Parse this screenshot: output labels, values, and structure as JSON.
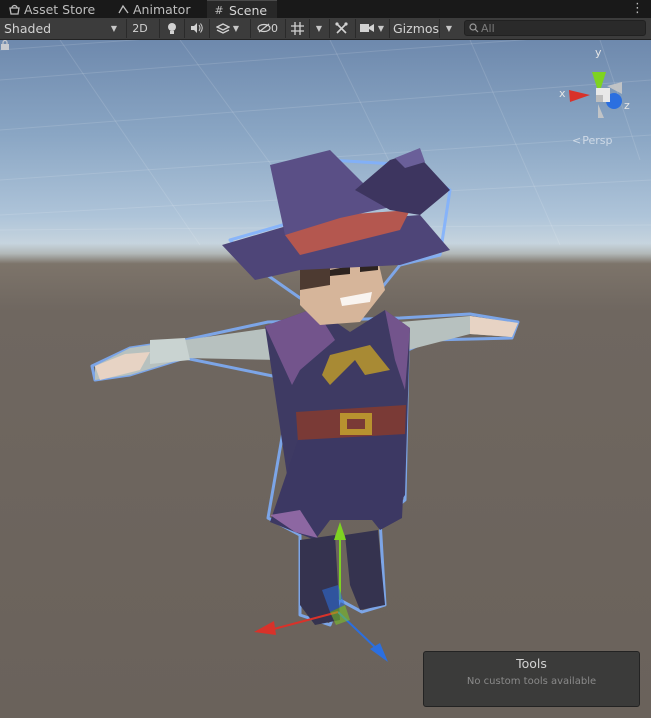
{
  "tabs": [
    {
      "label": "Asset Store",
      "icon": "asset-store-icon"
    },
    {
      "label": "Animator",
      "icon": "animator-icon"
    },
    {
      "label": "Scene",
      "icon": "scene-grid-icon",
      "active": true
    }
  ],
  "toolbar": {
    "draw_mode": "Shaded",
    "mode_2d": "2D",
    "hidden_count": "0",
    "gizmos_label": "Gizmos",
    "search_placeholder": "All"
  },
  "orientation_gizmo": {
    "x_label": "x",
    "y_label": "y",
    "z_label": "z",
    "projection_label": "Persp"
  },
  "tools_panel": {
    "title": "Tools",
    "subtitle": "No custom tools available"
  },
  "colors": {
    "axis_x": "#d8322a",
    "axis_y": "#7ed321",
    "axis_z": "#2b6fe0",
    "selection_outline": "#7fb0ff"
  }
}
